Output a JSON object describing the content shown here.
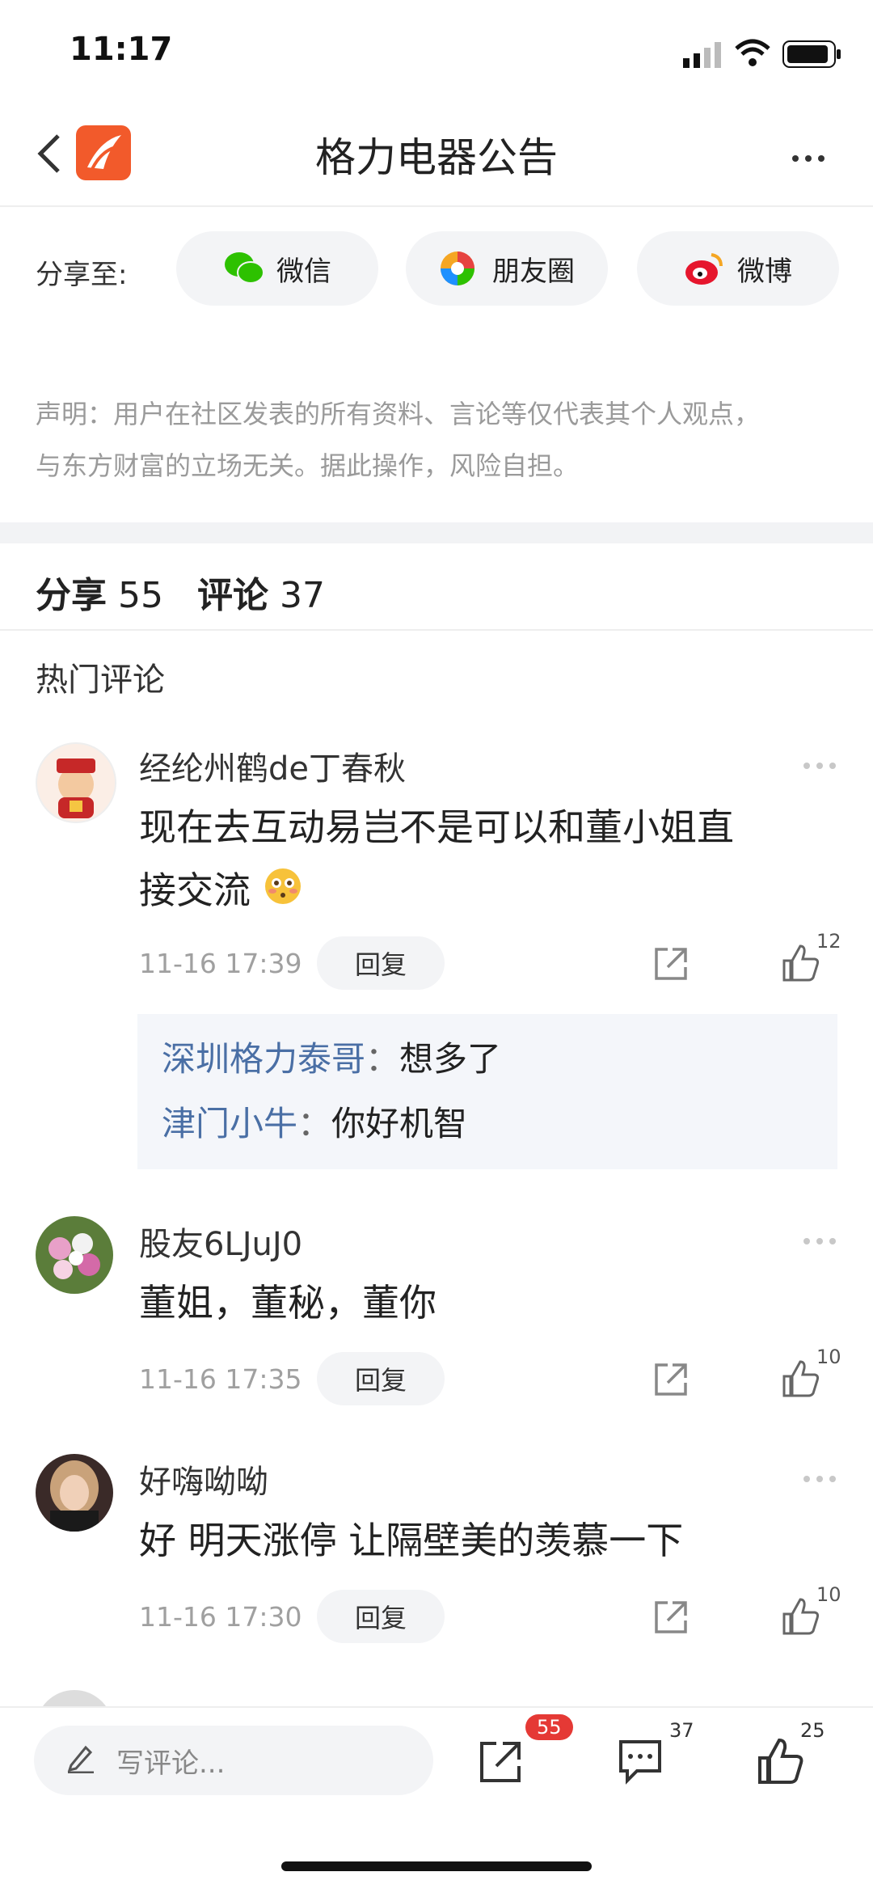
{
  "status": {
    "time": "11:17"
  },
  "nav": {
    "title": "格力电器公告"
  },
  "share": {
    "label": "分享至:",
    "buttons": [
      {
        "label": "微信",
        "icon": "wechat-icon",
        "color": "#2dc100"
      },
      {
        "label": "朋友圈",
        "icon": "moments-icon",
        "color": "#f5a623"
      },
      {
        "label": "微博",
        "icon": "weibo-icon",
        "color": "#e6162d"
      }
    ]
  },
  "disclaimer": {
    "line1": "声明：用户在社区发表的所有资料、言论等仅代表其个人观点，",
    "line2": "与东方财富的立场无关。据此操作，风险自担。"
  },
  "counts": {
    "share_label": "分享",
    "share_count": "55",
    "comment_label": "评论",
    "comment_count": "37"
  },
  "hot_title": "热门评论",
  "comments": [
    {
      "user": "经纶州鹤de丁春秋",
      "text_line1": "现在去互动易岂不是可以和董小姐直",
      "text_line2": "接交流",
      "time": "11-16 17:39",
      "reply": "回复",
      "likes": "12",
      "replies": [
        {
          "user": "深圳格力泰哥",
          "sep": "：",
          "text": "想多了"
        },
        {
          "user": "津门小牛",
          "sep": "：",
          "text": "你好机智"
        }
      ]
    },
    {
      "user": "股友6LJuJ0",
      "text_line1": "董姐，董秘，董你",
      "time": "11-16 17:35",
      "reply": "回复",
      "likes": "10"
    },
    {
      "user": "好嗨呦呦",
      "text_line1": "好 明天涨停 让隔壁美的羡慕一下",
      "time": "11-16 17:30",
      "reply": "回复",
      "likes": "10"
    }
  ],
  "bottom": {
    "placeholder": "写评论...",
    "share_badge": "55",
    "comment_count": "37",
    "like_count": "25"
  },
  "colors": {
    "accent": "#f25a2b",
    "reply_user": "#4a6fa5",
    "badge": "#e53935"
  }
}
